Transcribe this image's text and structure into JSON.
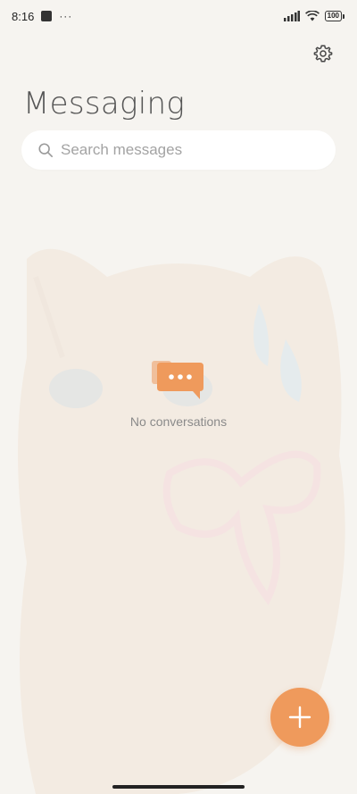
{
  "status_bar": {
    "time": "8:16",
    "notification_dots": "···",
    "battery": "100"
  },
  "header": {
    "title": "Messaging",
    "settings_icon": "gear-icon"
  },
  "search": {
    "placeholder": "Search messages"
  },
  "empty_state": {
    "icon": "chat-bubble-icon",
    "label": "No conversations"
  },
  "fab": {
    "icon": "plus-icon"
  },
  "colors": {
    "accent": "#ef9a5c",
    "background": "#f6f4f0"
  }
}
